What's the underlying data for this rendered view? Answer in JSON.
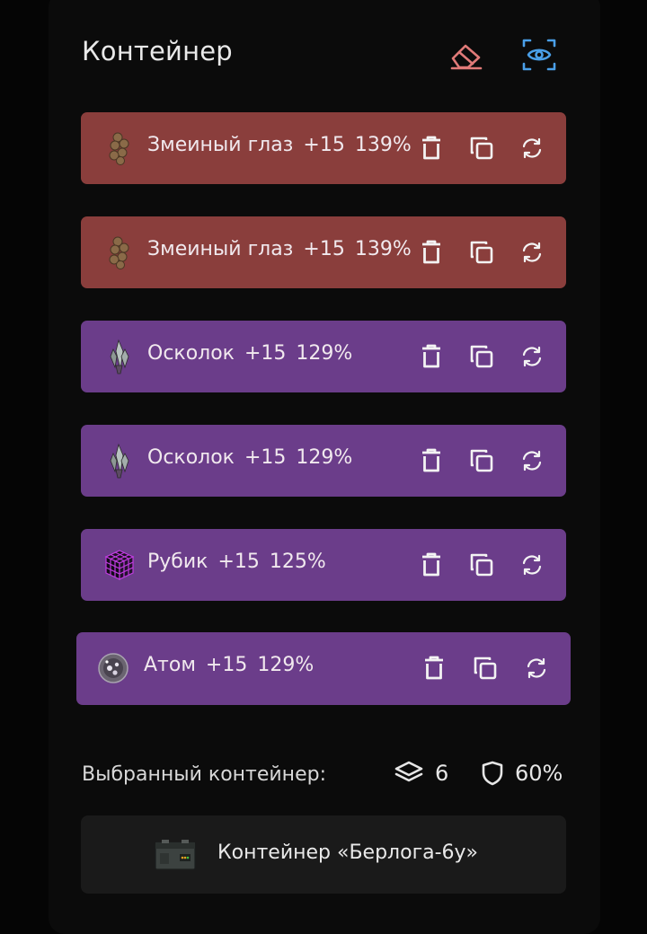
{
  "header": {
    "title": "Контейнер",
    "eraser_icon": "eraser-icon",
    "eye_icon": "eye-icon",
    "colors": {
      "eraser": "#e07a78",
      "eye": "#4a9fe8"
    }
  },
  "items": [
    {
      "name": "Змеиный глаз",
      "level": "+15",
      "percent": "139%",
      "rarity": "red",
      "icon": "snake-eye-icon"
    },
    {
      "name": "Змеиный глаз",
      "level": "+15",
      "percent": "139%",
      "rarity": "red",
      "icon": "snake-eye-icon"
    },
    {
      "name": "Осколок",
      "level": "+15",
      "percent": "129%",
      "rarity": "purple",
      "icon": "shard-icon"
    },
    {
      "name": "Осколок",
      "level": "+15",
      "percent": "129%",
      "rarity": "purple",
      "icon": "shard-icon"
    },
    {
      "name": "Рубик",
      "level": "+15",
      "percent": "125%",
      "rarity": "purple",
      "icon": "cube-icon"
    },
    {
      "name": "Атом",
      "level": "+15",
      "percent": "129%",
      "rarity": "purple",
      "icon": "atom-icon"
    }
  ],
  "item_actions": [
    "trash-icon",
    "copy-icon",
    "swap-icon"
  ],
  "colors": {
    "red_item": "#8a3e3c",
    "purple_item": "#6b3d8a",
    "background": "#0b0b0b"
  },
  "footer": {
    "label": "Выбранный контейнер:",
    "slots_count": "6",
    "protection": "60%",
    "layers_icon": "layers-icon",
    "shield_icon": "shield-icon"
  },
  "selected_container": {
    "name": "Контейнер «Берлога-6у»",
    "icon": "container-box-icon"
  }
}
